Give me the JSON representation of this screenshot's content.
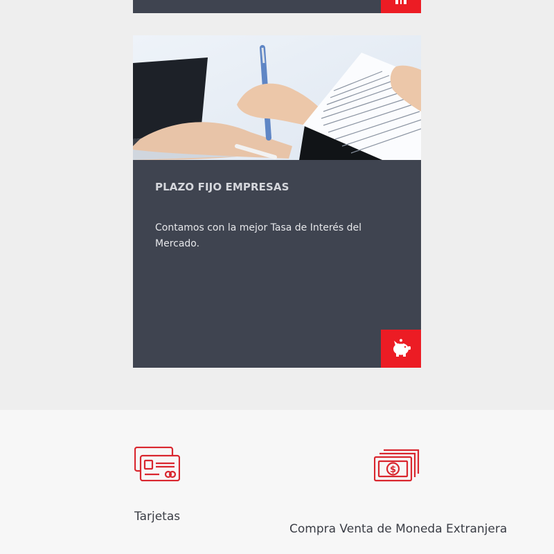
{
  "top_card": {
    "icon": "building-icon"
  },
  "card": {
    "image": "signing-document-photo",
    "title": "PLAZO FIJO EMPRESAS",
    "description": "Contamos con la mejor Tasa de Interés del Mercado.",
    "button_icon": "piggy-bank-icon"
  },
  "services": [
    {
      "label": "Tarjetas",
      "icon": "credit-card-icon"
    },
    {
      "label": "Compra Venta de Moneda Extranjera",
      "icon": "money-bills-icon"
    }
  ],
  "colors": {
    "accent": "#ec1c24",
    "card_bg": "#3f4450",
    "page_bg": "#eeeeee",
    "services_bg": "#f7f7f7"
  }
}
